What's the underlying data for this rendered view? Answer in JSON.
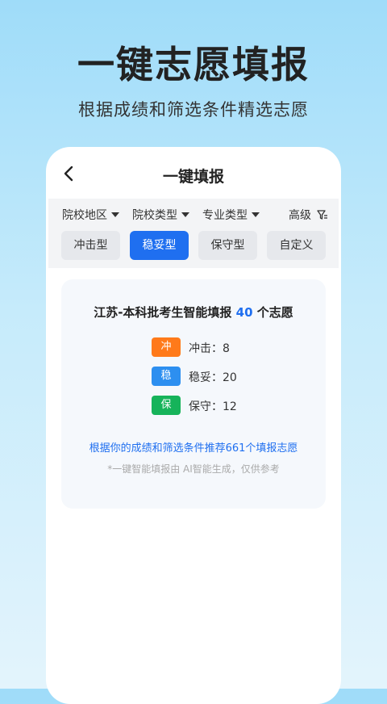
{
  "hero": {
    "title": "一键志愿填报",
    "subtitle": "根据成绩和筛选条件精选志愿"
  },
  "nav": {
    "title": "一键填报",
    "back_icon": "chevron-left-icon"
  },
  "filters": [
    {
      "label": "院校地区"
    },
    {
      "label": "院校类型"
    },
    {
      "label": "专业类型"
    }
  ],
  "advanced": {
    "label": "高级",
    "icon": "filter-icon"
  },
  "tabs": [
    {
      "label": "冲击型",
      "active": false
    },
    {
      "label": "稳妥型",
      "active": true
    },
    {
      "label": "保守型",
      "active": false
    },
    {
      "label": "自定义",
      "active": false
    }
  ],
  "summary": {
    "prefix": "江苏-本科批考生智能填报",
    "count": "40",
    "suffix": "个志愿",
    "rows": [
      {
        "badge": "冲",
        "label": "冲击：8",
        "color": "#ff7a1a"
      },
      {
        "badge": "稳",
        "label": "稳妥：20",
        "color": "#2d8ff0"
      },
      {
        "badge": "保",
        "label": "保守：12",
        "color": "#16b35a"
      }
    ],
    "recommend_text": "根据你的成绩和筛选条件推荐661个填报志愿",
    "disclaimer": "*一键智能填报由 AI智能生成，仅供参考"
  }
}
